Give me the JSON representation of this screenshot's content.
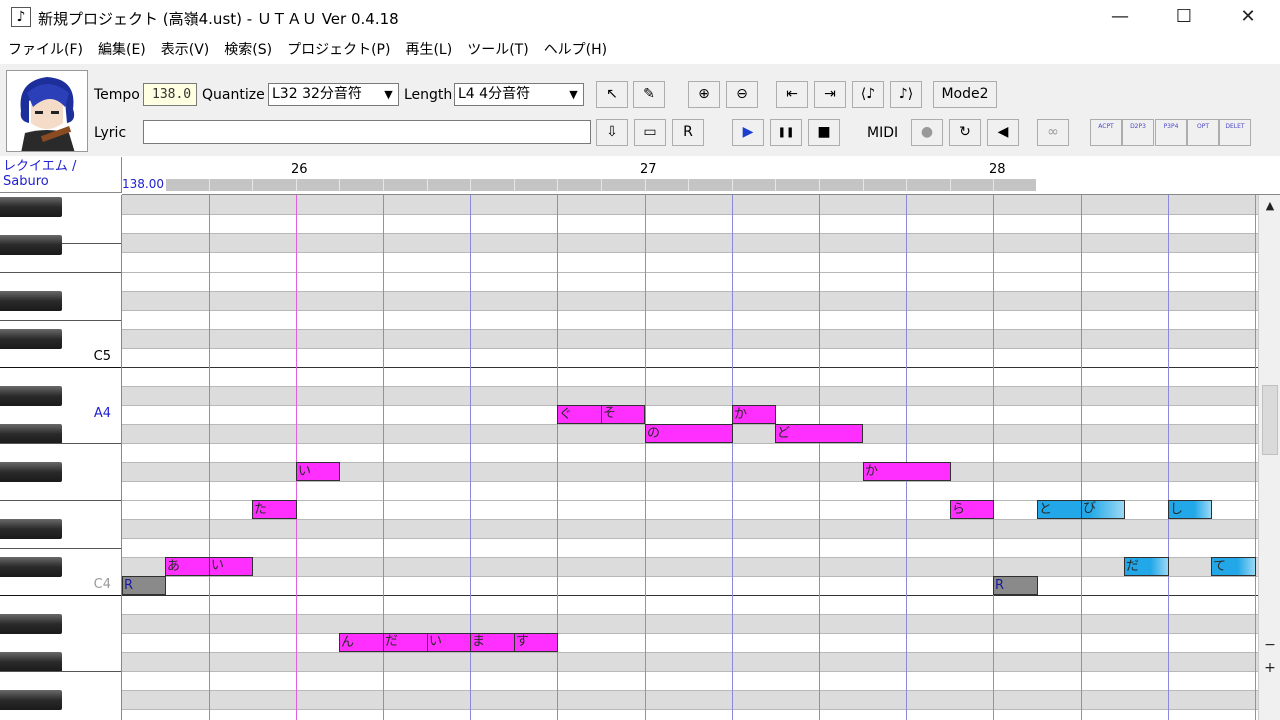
{
  "window": {
    "title": "新規プロジェクト (高嶺4.ust) - ＵＴＡＵ Ver 0.4.18",
    "minimize_glyph": "—",
    "maximize_glyph": "☐",
    "close_glyph": "✕",
    "app_icon_glyph": "♪"
  },
  "menu": [
    {
      "label": "ファイル(F)"
    },
    {
      "label": "編集(E)"
    },
    {
      "label": "表示(V)"
    },
    {
      "label": "検索(S)"
    },
    {
      "label": "プロジェクト(P)"
    },
    {
      "label": "再生(L)"
    },
    {
      "label": "ツール(T)"
    },
    {
      "label": "ヘルプ(H)"
    }
  ],
  "toolbar": {
    "tempo_label": "Tempo",
    "tempo_value": "138.0",
    "quantize_label": "Quantize",
    "quantize_value": "L32 32分音符",
    "length_label": "Length",
    "length_value": "L4  4分音符",
    "lyric_label": "Lyric",
    "lyric_value": "",
    "mode_label": "Mode2",
    "midi_label": "MIDI",
    "icons": {
      "pointer": "↖",
      "pencil": "✎",
      "zoom_in": "⊕",
      "zoom_out": "⊖",
      "go_start": "⇤",
      "go_end": "⇥",
      "prev_note": "⟨♪",
      "next_note": "♪⟩",
      "insert": "⇩",
      "erase": "▭",
      "insert_rest": "R",
      "play": "▶",
      "pause": "❚❚",
      "stop": "■",
      "record": "●",
      "loop": "↻",
      "speaker": "◀",
      "link": "∞"
    },
    "small_buttons": [
      "ACPT",
      "D2P3",
      "P3P4",
      "OPT",
      "DELET"
    ]
  },
  "editor": {
    "singer_line1": "レクイエム /",
    "singer_line2": "Saburo",
    "tempo_marker": "138.00",
    "measures": [
      "26",
      "27",
      "28"
    ],
    "key_labels": {
      "c5": "C5",
      "a4": "A4",
      "c4": "C4"
    },
    "notes": {
      "n_a_i": {
        "lyric": "あ",
        "lyric2": "い"
      },
      "n_ta": {
        "lyric": "た"
      },
      "n_i": {
        "lyric": "い"
      },
      "n_nda": {
        "lyric": "ん",
        "lyric2": "だ",
        "lyric3": "い",
        "lyric4": "ま",
        "lyric5": "す"
      },
      "n_gu_so": {
        "lyric": "ぐ",
        "lyric2": "そ"
      },
      "n_no": {
        "lyric": "の"
      },
      "n_ka": {
        "lyric": "か"
      },
      "n_do": {
        "lyric": "ど"
      },
      "n_ka2": {
        "lyric": "か"
      },
      "n_ra": {
        "lyric": "ら"
      },
      "n_to_bi": {
        "lyric": "と",
        "lyric2": "び"
      },
      "n_shi": {
        "lyric": "し"
      },
      "n_da": {
        "lyric": "だ"
      },
      "n_te": {
        "lyric": "て"
      },
      "n_rest1": {
        "lyric": "R"
      },
      "n_rest2": {
        "lyric": "R"
      }
    },
    "scroll": {
      "up": "▲",
      "minus": "−",
      "plus": "+"
    }
  }
}
